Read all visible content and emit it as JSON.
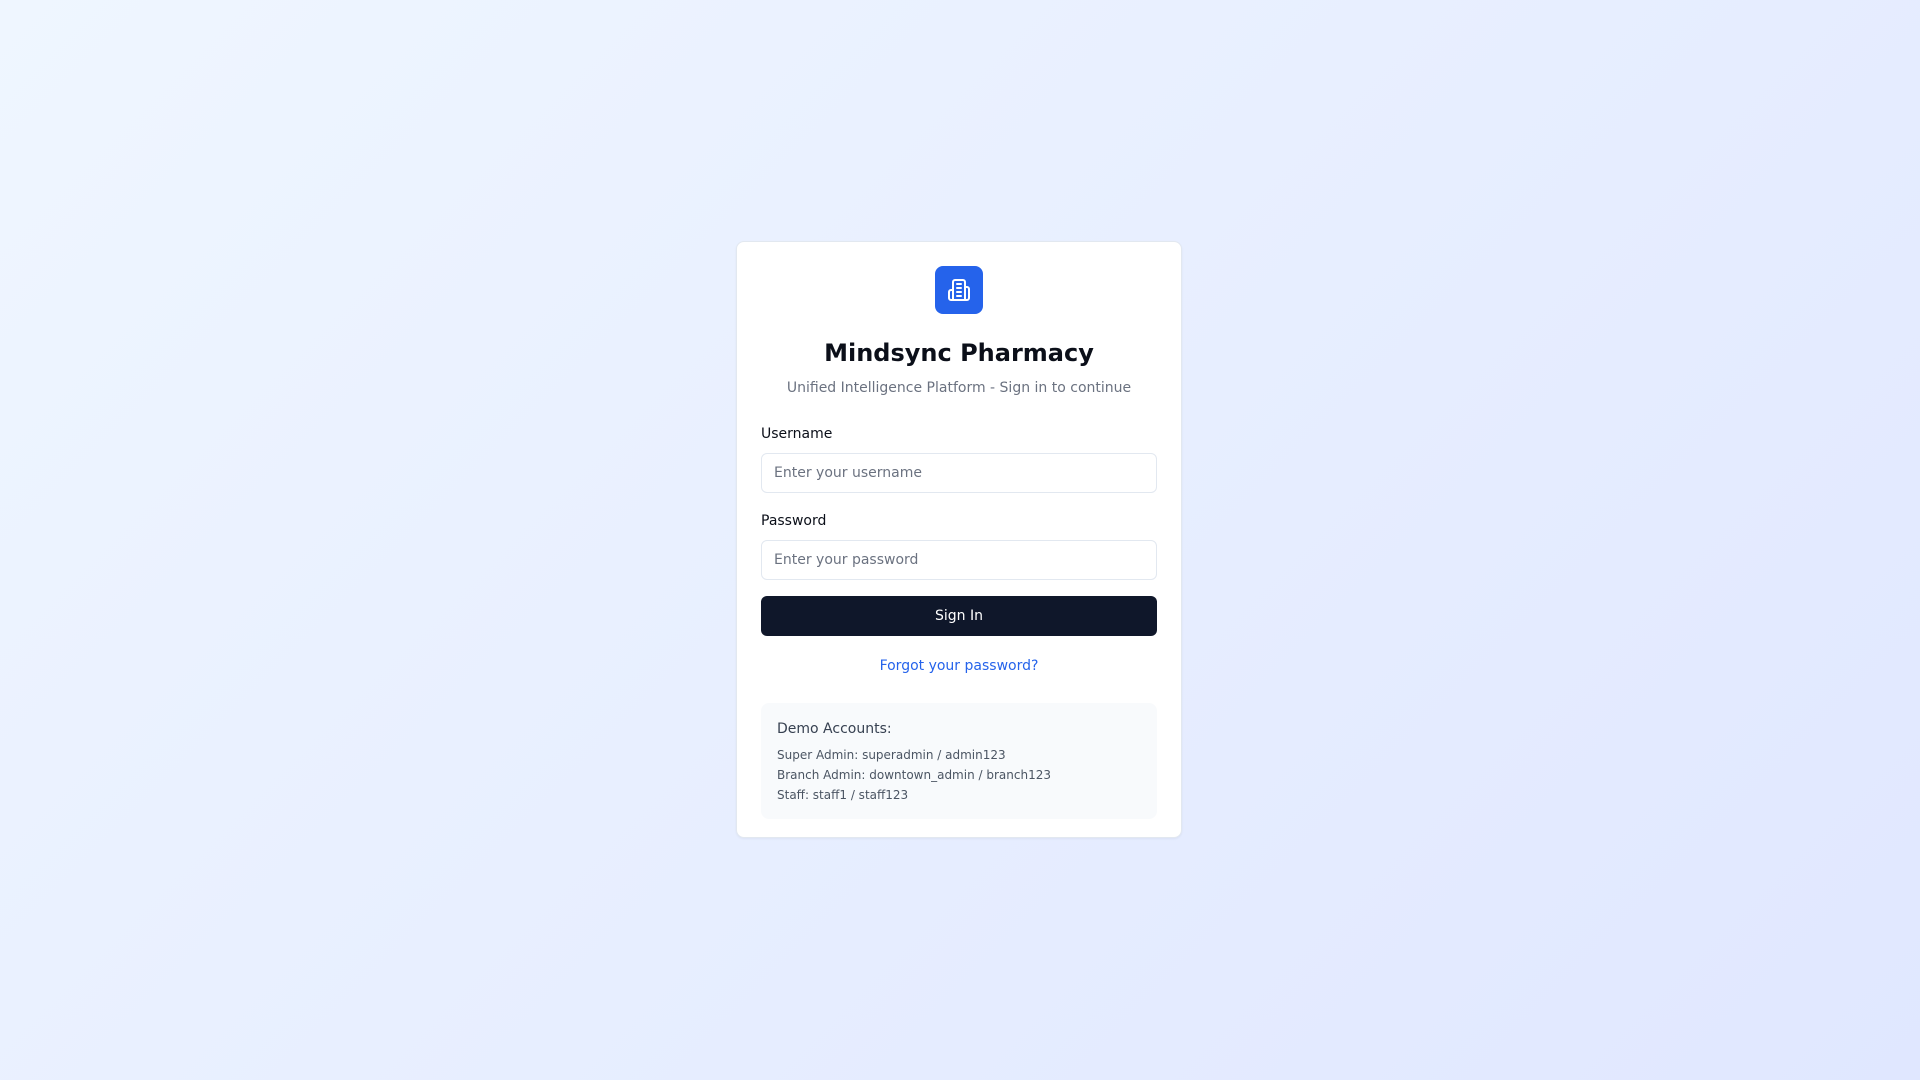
{
  "app": {
    "title": "Mindsync Pharmacy",
    "subtitle": "Unified Intelligence Platform - Sign in to continue",
    "logo_icon": "building-icon",
    "accent_color": "#2563eb"
  },
  "form": {
    "username_label": "Username",
    "username_placeholder": "Enter your username",
    "username_value": "",
    "password_label": "Password",
    "password_placeholder": "Enter your password",
    "password_value": "",
    "signin_label": "Sign In",
    "forgot_label": "Forgot your password?"
  },
  "demo": {
    "title": "Demo Accounts:",
    "accounts": [
      "Super Admin: superadmin / admin123",
      "Branch Admin: downtown_admin / branch123",
      "Staff: staff1 / staff123"
    ]
  }
}
